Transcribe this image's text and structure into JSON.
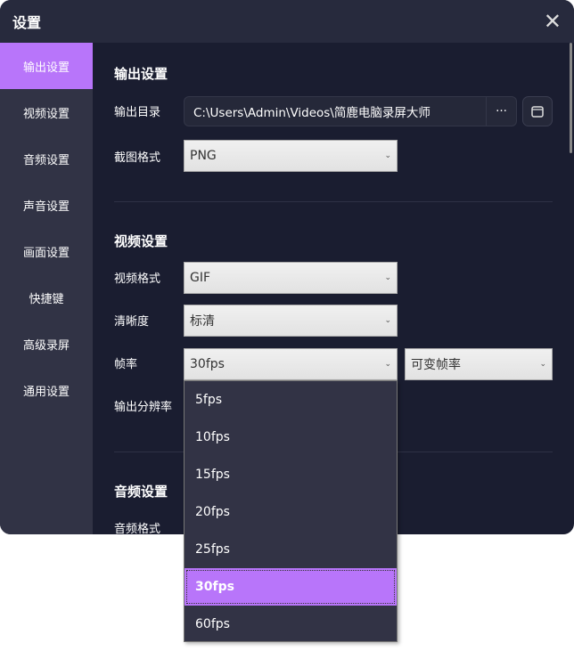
{
  "window": {
    "title": "设置"
  },
  "sidebar": {
    "items": [
      {
        "label": "输出设置"
      },
      {
        "label": "视频设置"
      },
      {
        "label": "音频设置"
      },
      {
        "label": "声音设置"
      },
      {
        "label": "画面设置"
      },
      {
        "label": "快捷键"
      },
      {
        "label": "高级录屏"
      },
      {
        "label": "通用设置"
      }
    ]
  },
  "output": {
    "heading": "输出设置",
    "dir_label": "输出目录",
    "dir_value": "C:\\Users\\Admin\\Videos\\简鹿电脑录屏大师",
    "more": "···",
    "shot_label": "截图格式",
    "shot_value": "PNG"
  },
  "video": {
    "heading": "视频设置",
    "format_label": "视频格式",
    "format_value": "GIF",
    "quality_label": "清晰度",
    "quality_value": "标清",
    "fps_label": "帧率",
    "fps_value": "30fps",
    "fps_mode_value": "可变帧率",
    "res_label": "输出分辨率"
  },
  "audio": {
    "heading": "音频设置",
    "format_label": "音频格式"
  },
  "fps_options": [
    "5fps",
    "10fps",
    "15fps",
    "20fps",
    "25fps",
    "30fps",
    "60fps"
  ],
  "accent": "#b875fa"
}
